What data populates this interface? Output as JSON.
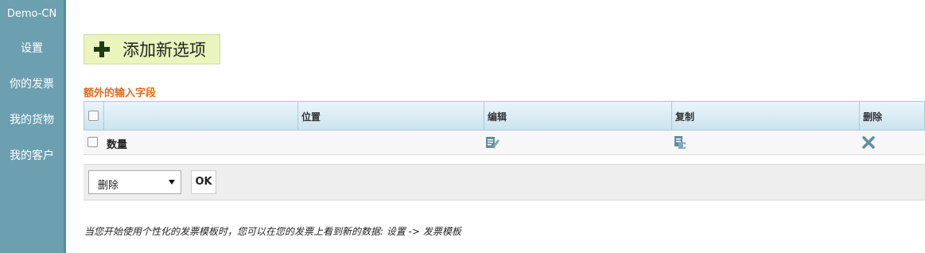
{
  "sidebar": {
    "brand": "Demo-CN",
    "items": [
      {
        "label": "设置"
      },
      {
        "label": "你的发票"
      },
      {
        "label": "我的货物"
      },
      {
        "label": "我的客户"
      }
    ]
  },
  "toolbar": {
    "add_label": "添加新选项"
  },
  "section": {
    "title": "额外的输入字段"
  },
  "table": {
    "headers": {
      "position": "位置",
      "edit": "编辑",
      "copy": "复制",
      "delete": "删除"
    },
    "rows": [
      {
        "name": "数量",
        "position": ""
      }
    ]
  },
  "bulk": {
    "action_selected": "删除",
    "ok_label": "OK"
  },
  "footer": {
    "note": "当您开始使用个性化的发票模板时，您可以在您的发票上看到新的数据: 设置 -> 发票模板"
  },
  "colors": {
    "sidebar": "#6c9fb0",
    "add_button_bg": "#eaf5be",
    "section_title": "#e06c1d",
    "header_bg": "#cce3ee",
    "icon_blue": "#5f8ea3"
  }
}
